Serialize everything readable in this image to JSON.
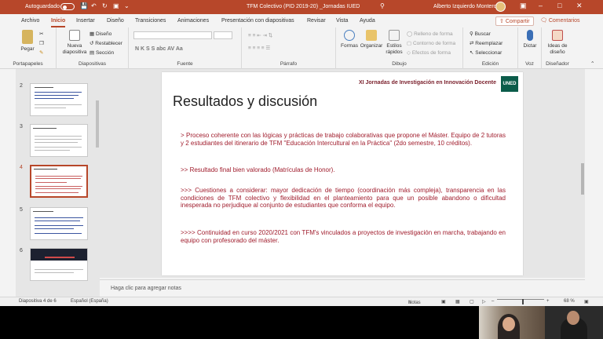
{
  "titlebar": {
    "autosave_label": "Autoguardado",
    "autosave_state": "off",
    "doc_title": "TFM Colectivo (PID 2019-20) _Jornadas IUED",
    "user_name": "Alberto Izquierdo Montero",
    "colors": {
      "accent": "#b7472a"
    }
  },
  "tabs": {
    "items": [
      "Archivo",
      "Inicio",
      "Insertar",
      "Diseño",
      "Transiciones",
      "Animaciones",
      "Presentación con diapositivas",
      "Revisar",
      "Vista",
      "Ayuda"
    ],
    "active": "Inicio",
    "share": "Compartir",
    "comments": "Comentarios"
  },
  "ribbon": {
    "portapapeles": {
      "paste": "Pegar",
      "label": "Portapapeles"
    },
    "diapositivas": {
      "new_slide_1": "Nueva",
      "new_slide_2": "diapositiva",
      "layout": "Diseño",
      "reset": "Restablecer",
      "section": "Sección",
      "label": "Diapositivas"
    },
    "fuente": {
      "format_buttons": "N K S S abc AV Aa",
      "label": "Fuente"
    },
    "parrafo": {
      "label": "Párrafo"
    },
    "dibujo": {
      "shapes": "Formas",
      "arrange": "Organizar",
      "quick_styles_1": "Estilos",
      "quick_styles_2": "rápidos",
      "fill": "Relleno de forma",
      "outline": "Contorno de forma",
      "effects": "Efectos de forma",
      "label": "Dibujo"
    },
    "edicion": {
      "find": "Buscar",
      "replace": "Reemplazar",
      "select": "Seleccionar",
      "label": "Edición"
    },
    "voz": {
      "dictate": "Dictar",
      "label": "Voz"
    },
    "disenador": {
      "ideas_1": "Ideas de",
      "ideas_2": "diseño",
      "label": "Diseñador"
    }
  },
  "thumbnails": [
    {
      "num": "2",
      "selected": false,
      "dark": false
    },
    {
      "num": "3",
      "selected": false,
      "dark": false
    },
    {
      "num": "4",
      "selected": true,
      "dark": false
    },
    {
      "num": "5",
      "selected": false,
      "dark": false
    },
    {
      "num": "6",
      "selected": false,
      "dark": true
    }
  ],
  "slide": {
    "header": "XI Jornadas de Investigación en Innovación Docente",
    "logo": "UNED",
    "title": "Resultados y discusión",
    "bullets": [
      "> Proceso coherente con las lógicas y prácticas de trabajo colaborativas que propone el Máster. Equipo de 2 tutoras y 2 estudiantes del itinerario de TFM \"Educación Intercultural en la Práctica\" (2do semestre, 10 créditos).",
      ">> Resultado final bien valorado (Matrículas de Honor).",
      ">>> Cuestiones a considerar: mayor dedicación de tiempo (coordinación más compleja), transparencia en las condiciones de TFM colectivo y flexibilidad en el planteamiento para que un posible abandono o dificultad inesperada no perjudique al conjunto de estudiantes que conforma el equipo.",
      ">>>> Continuidad en curso 2020/2021 con TFM's vinculados a proyectos de investigación en marcha, trabajando en equipo con profesorado del máster."
    ],
    "colors": {
      "text": "#a01c2c",
      "header": "#7a1f2b",
      "logo_bg": "#0b5c4a"
    }
  },
  "notes": {
    "placeholder": "Haga clic para agregar notas"
  },
  "status": {
    "slide_counter": "Diapositiva 4 de 6",
    "language": "Español (España)",
    "notes": "Notas",
    "zoom": "68 %"
  }
}
